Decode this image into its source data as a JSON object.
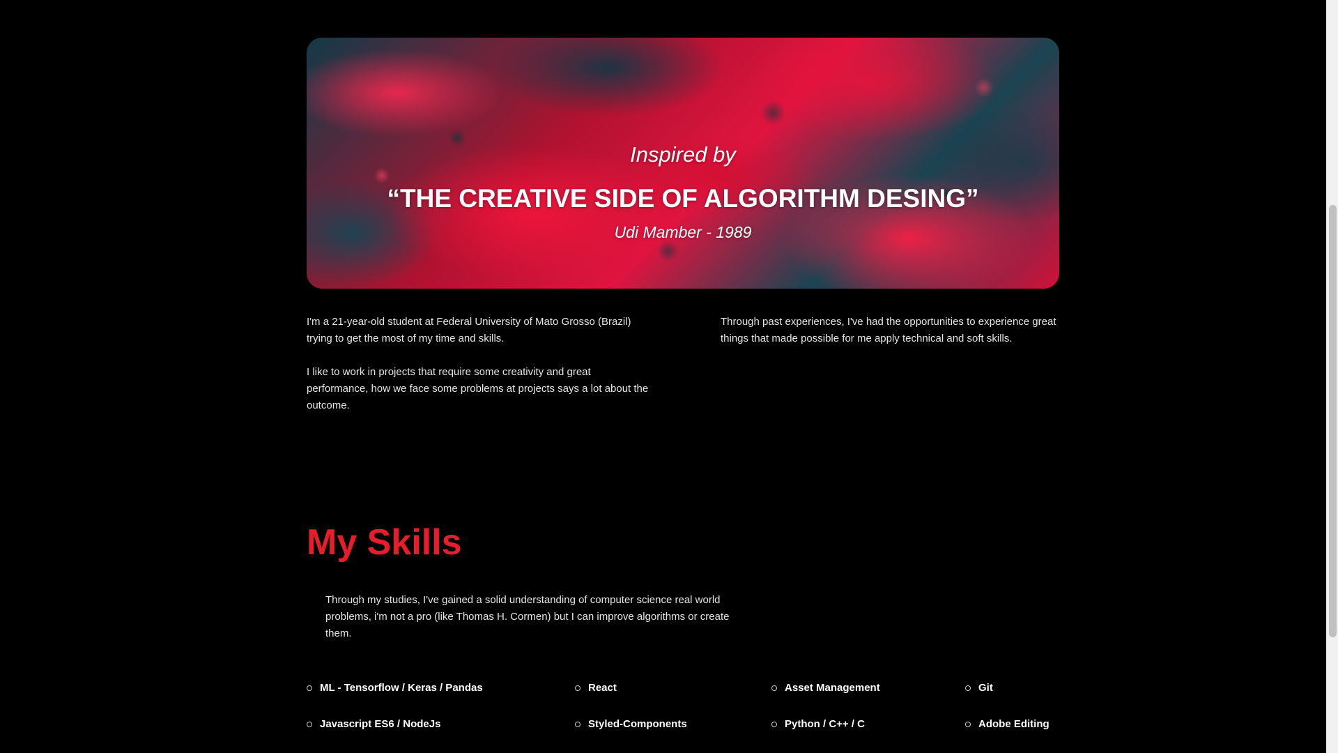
{
  "banner": {
    "inspired": "Inspired by",
    "quote": "“THE CREATIVE SIDE OF ALGORITHM DESING”",
    "author": "Udi Mamber - 1989"
  },
  "about": {
    "paragraph1": "I'm a 21-year-old student at Federal University of Mato Grosso (Brazil) trying to get the most of my time and skills.",
    "paragraph2": "I like to work in projects that require some creativity and great performance, how we face some problems at projects says a lot about the outcome.",
    "paragraph3": "Through past experiences, I've had the opportunities to experience great things that made possible for me apply technical and soft skills."
  },
  "skills": {
    "title": "My Skills",
    "description": "Through my studies, I've gained a solid understanding of computer science real world problems, i'm not a pro (like Thomas H. Cormen) but I can improve algorithms or create them.",
    "items": [
      "ML - Tensorflow / Keras / Pandas",
      "React",
      "Asset Management",
      "Git",
      "Javascript ES6 / NodeJs",
      "Styled-Components",
      "Python / C++ / C",
      "Adobe Editing"
    ]
  },
  "colors": {
    "accent": "#e81d2c",
    "background": "#000000"
  }
}
